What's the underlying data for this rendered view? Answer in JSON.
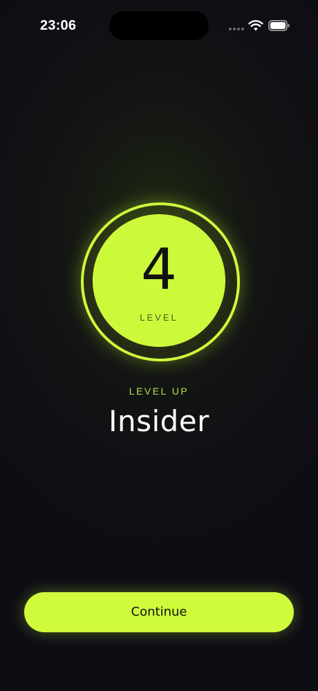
{
  "status_bar": {
    "time": "23:06",
    "icons": [
      "cellular-signal-icon",
      "wifi-icon",
      "battery-icon"
    ]
  },
  "badge": {
    "level_number": "4",
    "caption": "LEVEL"
  },
  "level_up_label": "LEVEL UP",
  "level_name": "Insider",
  "continue_button_label": "Continue",
  "colors": {
    "accent": "#cffb3c",
    "background": "#0d0d14",
    "level_up_text": "#b9e040"
  }
}
